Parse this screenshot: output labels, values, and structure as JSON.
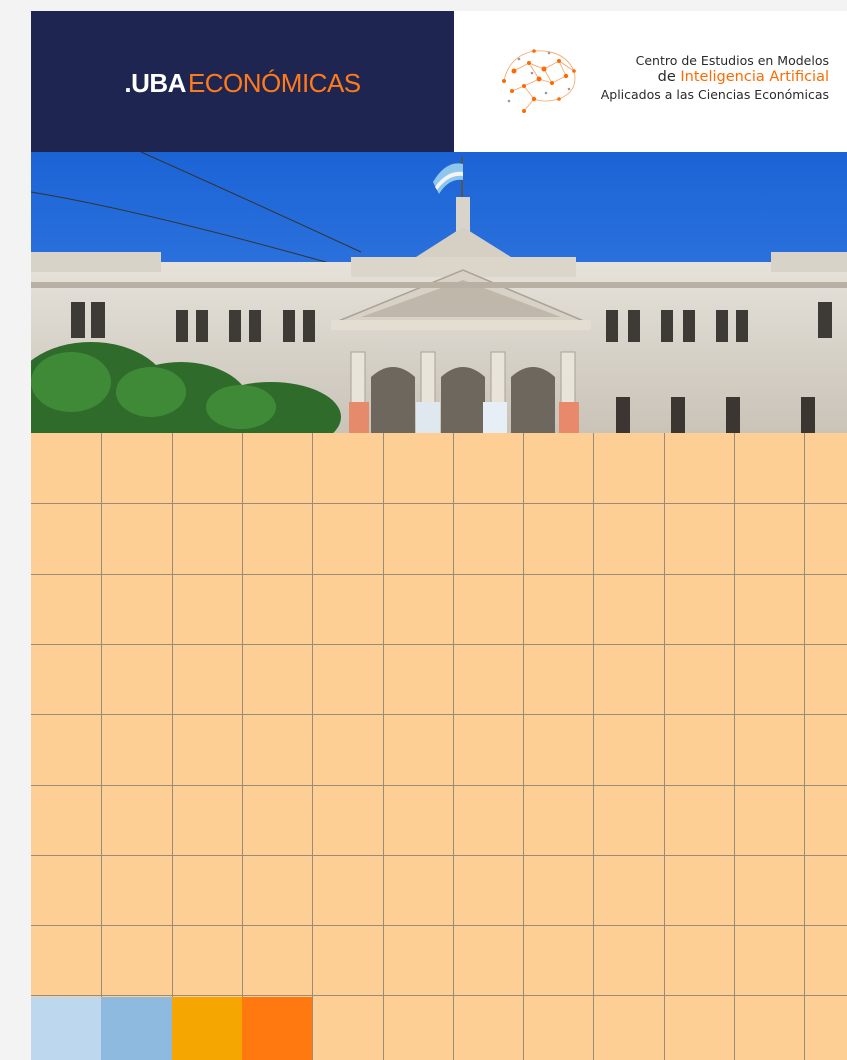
{
  "header": {
    "uba_logo": {
      "prefix": ".UBA",
      "suffix": "ECONÓMICAS"
    },
    "center_logo": {
      "line1": "Centro de Estudios en Modelos",
      "line2_prefix": "de ",
      "line2_accent": "Inteligencia Artificial",
      "line3": "Aplicados a las Ciencias Económicas"
    }
  },
  "colors": {
    "navy": "#1e2550",
    "orange": "#ff7a1a",
    "grid_fill": "#fdcf94",
    "swatches": [
      "#bdd7ee",
      "#8fbadf",
      "#f6a600",
      "#ff7910"
    ]
  },
  "photo": {
    "subject": "building-facade-photo"
  }
}
